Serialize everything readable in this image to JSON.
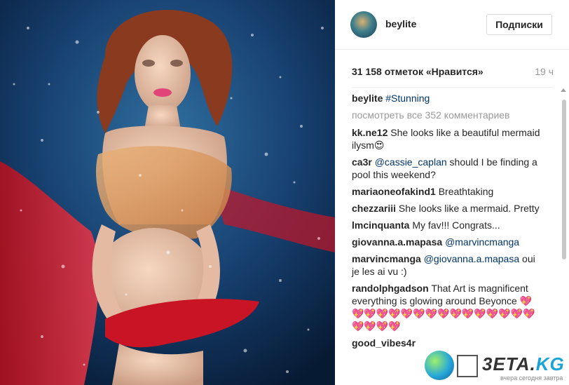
{
  "post": {
    "username": "beylite",
    "follow_label": "Подписки",
    "likes_text": "31 158 отметок «Нравится»",
    "time_ago": "19 ч",
    "caption_user": "beylite",
    "caption_tag": "#Stunning",
    "view_all_comments": "посмотреть все 352 комментариев"
  },
  "comments": [
    {
      "user": "kk.ne12",
      "text": "She looks like a beautiful mermaid ilysm😍"
    },
    {
      "user": "ca3r",
      "mention": "@cassie_caplan",
      "text": " should I be finding a pool this weekend?"
    },
    {
      "user": "mariaoneofakind1",
      "text": "Breathtaking"
    },
    {
      "user": "chezzariii",
      "text": "She looks like a mermaid. Pretty"
    },
    {
      "user": "lmcinquanta",
      "text": "My fav!!! Congrats..."
    },
    {
      "user": "giovanna.a.mapasa",
      "mention": "@marvincmanga",
      "text": ""
    },
    {
      "user": "marvincmanga",
      "mention": "@giovanna.a.mapasa",
      "text": " oui je les ai vu :)"
    },
    {
      "user": "randolphgadson",
      "text": "That Art is magnificent everything is glowing around Beyonce",
      "hearts": "💖💖💖💖💖💖💖💖💖💖💖💖💖💖💖💖💖💖💖💖"
    },
    {
      "user": "good_vibes4r",
      "text": ""
    }
  ],
  "watermark": {
    "brand": "3ETA.",
    "tld": "KG",
    "tagline": "вчера сегодня завтра"
  },
  "icons": [
    "avatar",
    "scroll-up-arrow",
    "watermark-globe-icon",
    "watermark-hourglass-icon"
  ]
}
